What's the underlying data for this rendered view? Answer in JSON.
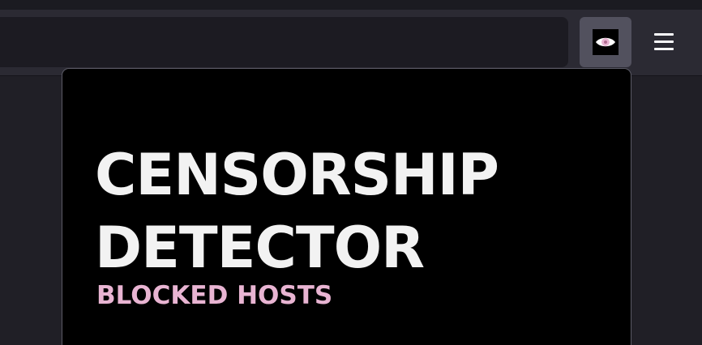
{
  "extension": {
    "icon": "eye-icon",
    "icon_color": "#e8b4d2"
  },
  "toolbar": {
    "menu_icon": "hamburger-menu-icon"
  },
  "popup": {
    "title_line1": "CENSORSHIP",
    "title_line2": "DETECTOR",
    "subtitle": "BLOCKED HOSTS",
    "title_color": "#f2f2f2",
    "subtitle_color": "#e8b4d2",
    "background": "#000000"
  }
}
